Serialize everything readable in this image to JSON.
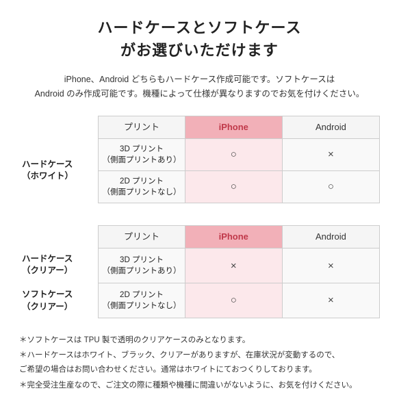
{
  "title": {
    "line1": "ハードケースとソフトケース",
    "line2": "がお選びいただけます"
  },
  "description": "iPhone、Android どちらもハードケース作成可能です。ソフトケースは\nAndroid のみ作成可能です。機種によって仕様が異なりますのでお気を付けください。",
  "table1": {
    "row_group_label": "ハードケース\n（ホワイト）",
    "headers": [
      "プリント",
      "iPhone",
      "Android"
    ],
    "rows": [
      {
        "label": "3D プリント\n（側面プリントあり）",
        "iphone": "○",
        "android": "×"
      },
      {
        "label": "2D プリント\n（側面プリントなし）",
        "iphone": "○",
        "android": "○"
      }
    ]
  },
  "table2": {
    "row_group_label1": "ハードケース\n（クリアー）",
    "row_group_label2": "ソフトケース\n（クリアー）",
    "headers": [
      "プリント",
      "iPhone",
      "Android"
    ],
    "rows": [
      {
        "label": "3D プリント\n（側面プリントあり）",
        "iphone": "×",
        "android": "×"
      },
      {
        "label": "2D プリント\n（側面プリントなし）",
        "iphone": "○",
        "android": "×"
      }
    ]
  },
  "notes": [
    "＊ソフトケースは TPU 製で透明のクリアケースのみとなります。",
    "＊ハードケースはホワイト、ブラック、クリアーがありますが、在庫状況が変動するので、\nご希望の場合はお問い合わせください。通常はホワイトにておつくりしております。",
    "＊完全受注生産なので、ご注文の際に種類や機種に間違いがないように、お気を付けください。"
  ]
}
